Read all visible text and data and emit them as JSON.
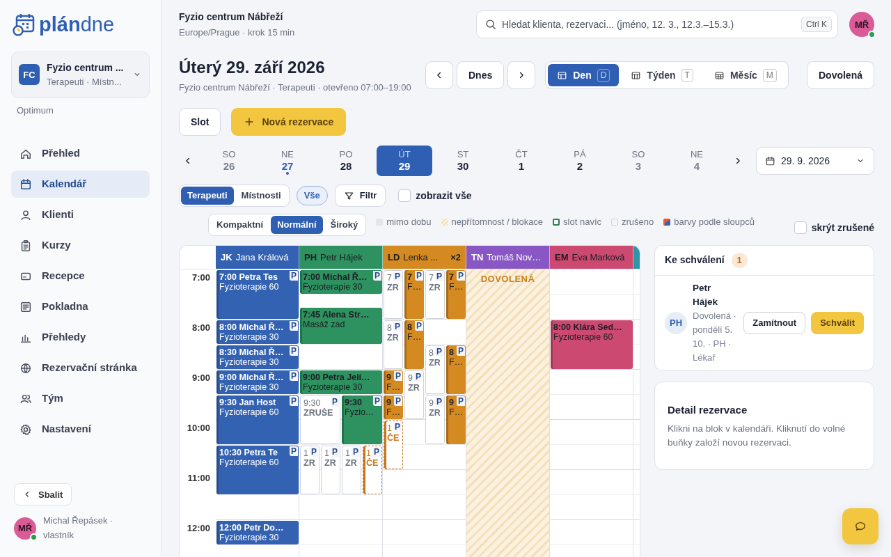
{
  "sidebar": {
    "logo": {
      "bold": "plán",
      "light": "dne"
    },
    "org": {
      "initials": "FC",
      "name": "Fyzio centrum ...",
      "sub": "Terapeuti · Místn..."
    },
    "plan": "Optimum",
    "items": [
      {
        "label": "Přehled",
        "selected": false
      },
      {
        "label": "Kalendář",
        "selected": true
      },
      {
        "label": "Klienti",
        "selected": false
      },
      {
        "label": "Kurzy",
        "selected": false
      },
      {
        "label": "Recepce",
        "selected": false
      },
      {
        "label": "Pokladna",
        "selected": false
      },
      {
        "label": "Přehledy",
        "selected": false
      },
      {
        "label": "Rezervační stránka",
        "selected": false
      },
      {
        "label": "Tým",
        "selected": false
      },
      {
        "label": "Nastavení",
        "selected": false
      }
    ],
    "collapse": "Sbalit",
    "user": {
      "initials": "MŘ",
      "text": "Michal Řepásek · vlastník",
      "online": true
    }
  },
  "header": {
    "title": "Fyzio centrum Nábřeží",
    "sub": "Europe/Prague · krok 15 min",
    "search": {
      "placeholder": "Hledat klienta, rezervaci... (jméno, 12. 3., 12.3.–15.3.)",
      "shortcut": "Ctrl K"
    },
    "avatar": {
      "initials": "MŘ",
      "online": true
    }
  },
  "day": {
    "title": "Úterý 29. září 2026",
    "sub": "Fyzio centrum Nábřeží · Terapeuti · otevřeno 07:00–19:00",
    "today": "Dnes",
    "views": [
      {
        "label": "Den",
        "key": "D",
        "selected": true
      },
      {
        "label": "Týden",
        "key": "T",
        "selected": false
      },
      {
        "label": "Měsíc",
        "key": "M",
        "selected": false
      }
    ],
    "vacation": "Dovolená",
    "slot": "Slot",
    "new": "Nová rezervace"
  },
  "days": [
    {
      "weekday": "SO",
      "day": "26",
      "selected": false,
      "muted": true,
      "today": false
    },
    {
      "weekday": "NE",
      "day": "27",
      "selected": false,
      "muted": false,
      "today": true
    },
    {
      "weekday": "PO",
      "day": "28",
      "selected": false,
      "muted": false,
      "today": false
    },
    {
      "weekday": "ÚT",
      "day": "29",
      "selected": true,
      "muted": false,
      "today": false
    },
    {
      "weekday": "ST",
      "day": "30",
      "selected": false,
      "muted": false,
      "today": false
    },
    {
      "weekday": "ČT",
      "day": "1",
      "selected": false,
      "muted": false,
      "today": false
    },
    {
      "weekday": "PÁ",
      "day": "2",
      "selected": false,
      "muted": false,
      "today": false
    },
    {
      "weekday": "SO",
      "day": "3",
      "selected": false,
      "muted": true,
      "today": false
    },
    {
      "weekday": "NE",
      "day": "4",
      "selected": false,
      "muted": true,
      "today": false
    }
  ],
  "date_picker": "29. 9. 2026",
  "filters": {
    "modes": [
      {
        "label": "Terapeuti",
        "selected": true
      },
      {
        "label": "Místnosti",
        "selected": false
      }
    ],
    "all": {
      "label": "Vše",
      "selected": true
    },
    "filter": "Filtr",
    "show_all": {
      "label": "zobrazit vše",
      "checked": false
    }
  },
  "density": [
    {
      "label": "Kompaktní",
      "selected": false
    },
    {
      "label": "Normální",
      "selected": true
    },
    {
      "label": "Široký",
      "selected": false
    }
  ],
  "legend": [
    {
      "kind": "off",
      "label": "mimo dobu"
    },
    {
      "kind": "absence",
      "label": "nepřítomnost / blokace"
    },
    {
      "kind": "extra",
      "label": "slot navíc"
    },
    {
      "kind": "cancelled",
      "label": "zrušeno"
    },
    {
      "kind": "colors",
      "label": "barvy podle sloupců"
    }
  ],
  "hide_cancelled": {
    "label": "skrýt zrušené",
    "checked": false
  },
  "calendar": {
    "hours": [
      "7:00",
      "8:00",
      "9:00",
      "10:00",
      "11:00",
      "12:00"
    ],
    "columns": [
      {
        "initials": "JK",
        "name": "Jana Králová",
        "color": "#3462b2",
        "clusters": [
          {
            "lanes": [
              [
                {
                  "kind": "booked",
                  "title": "7:00 Petra Tes",
                  "detail": "Fyzioterapie 60",
                  "tag": "P"
                }
              ]
            ]
          },
          {
            "lanes": [
              [
                {
                  "kind": "booked",
                  "title": "8:00 Michal Ř…",
                  "detail": "Fyzioterapie 30",
                  "tag": "P"
                }
              ]
            ]
          },
          {
            "lanes": [
              [
                {
                  "kind": "booked",
                  "title": "8:30 Michal Ř…",
                  "detail": "Fyzioterapie 30",
                  "tag": "P"
                }
              ]
            ]
          },
          {
            "lanes": [
              [
                {
                  "kind": "booked",
                  "title": "9:00 Michal Ř…",
                  "detail": "Fyzioterapie 30",
                  "tag": "P"
                }
              ]
            ]
          },
          {
            "lanes": [
              [
                {
                  "kind": "booked",
                  "title": "9:30 Jan Host",
                  "detail": "Fyzioterapie 60",
                  "tag": "P"
                }
              ]
            ]
          },
          {
            "lanes": [
              [
                {
                  "kind": "booked",
                  "title": "10:30 Petra Te",
                  "detail": "Fyzioterapie 60",
                  "tag": "P"
                }
              ]
            ]
          },
          {
            "lanes": [
              [
                {
                  "kind": "booked",
                  "title": "12:00 Petr Do…",
                  "detail": "Fyzioterapie 30"
                }
              ]
            ]
          }
        ]
      },
      {
        "initials": "PH",
        "name": "Petr Hájek",
        "color": "#2e9160",
        "clusters": [
          {
            "lanes": [
              [
                {
                  "kind": "booked",
                  "title": "7:00 Michal Ř…",
                  "detail": "Fyzioterapie 30",
                  "tag": "P"
                }
              ]
            ]
          },
          {
            "lanes": [
              [
                {
                  "kind": "booked",
                  "title": "7:45 Alena Str…",
                  "detail": "Masáž zad"
                }
              ]
            ]
          },
          {
            "lanes": [
              [
                {
                  "kind": "booked",
                  "title": "9:00 Petra Jelí…",
                  "detail": "Fyzioterapie 30"
                }
              ]
            ]
          },
          {
            "lanes": [
              [
                {
                  "kind": "cancelled",
                  "title": "9:30",
                  "detail": "ZRUŠE",
                  "tag": "P"
                }
              ],
              [
                {
                  "kind": "booked",
                  "title": "9:30",
                  "detail": "Fyzio…",
                  "tag": "P"
                }
              ]
            ]
          },
          {
            "lanes": [
              [
                {
                  "kind": "cancelled",
                  "title": "1",
                  "detail": "ZR",
                  "tag": "P"
                }
              ],
              [
                {
                  "kind": "cancelled",
                  "title": "1",
                  "detail": "ZR",
                  "tag": "P"
                }
              ],
              [
                {
                  "kind": "cancelled",
                  "title": "1",
                  "detail": "ZR",
                  "tag": "P"
                }
              ],
              [
                {
                  "kind": "pending",
                  "title": "1",
                  "detail": "ČE",
                  "tag": "P"
                }
              ]
            ]
          }
        ]
      },
      {
        "initials": "LD",
        "name": "Lenka ...",
        "count": "×2",
        "color": "#d48a20",
        "clusters": [
          {
            "lanes": [
              [
                {
                  "kind": "cancelled",
                  "title": "7",
                  "detail": "ZR",
                  "tag": "P"
                },
                {
                  "kind": "cancelled",
                  "title": "8",
                  "detail": "ZR",
                  "tag": "P"
                },
                {
                  "kind": "booked",
                  "title": "9",
                  "detail": "F…",
                  "tag": "P"
                },
                {
                  "kind": "booked",
                  "title": "9",
                  "detail": "F…",
                  "tag": "P"
                },
                {
                  "kind": "pending",
                  "title": "1",
                  "detail": "ČE",
                  "tag": "P"
                }
              ],
              [
                {
                  "kind": "booked",
                  "title": "7",
                  "detail": "F…",
                  "tag": "P"
                },
                {
                  "kind": "booked",
                  "title": "8",
                  "detail": "F…",
                  "tag": "P"
                },
                {
                  "kind": "cancelled",
                  "title": "9",
                  "detail": "ZR",
                  "tag": "P"
                }
              ],
              [
                {
                  "kind": "cancelled",
                  "title": "7",
                  "detail": "ZR",
                  "tag": "P"
                },
                {
                  "kind": "cancelled",
                  "title": "8",
                  "detail": "ZR",
                  "tag": "P"
                },
                {
                  "kind": "cancelled",
                  "title": "9",
                  "detail": "ZR",
                  "tag": "P"
                }
              ],
              [
                {
                  "kind": "booked",
                  "title": "7",
                  "detail": "F…",
                  "tag": "P"
                },
                {
                  "kind": "booked",
                  "title": "8",
                  "detail": "F…",
                  "tag": "P"
                },
                {
                  "kind": "booked",
                  "title": "9",
                  "detail": "F…",
                  "tag": "P"
                }
              ]
            ]
          }
        ]
      },
      {
        "initials": "TN",
        "name": "Tomáš Nov…",
        "color": "#8857c4",
        "absence": "DOVOLENÁ"
      },
      {
        "initials": "EM",
        "name": "Eva Marková",
        "color": "#cc4a72",
        "clusters": [
          {
            "lanes": [
              [
                {
                  "kind": "booked",
                  "title": "8:00 Klára Sed…",
                  "detail": "Fyzioterapie 60"
                }
              ]
            ]
          }
        ]
      }
    ],
    "clipped_column": {
      "color": "#2e97a6"
    }
  },
  "approvals": {
    "title": "Ke schválení",
    "count": "1",
    "items": [
      {
        "initials": "PH",
        "name": "Petr Hájek",
        "detail": "Dovolená · pondělí 5. 10. · PH · Lékař",
        "actions": [
          {
            "kind": "reject",
            "label": "Zamítnout"
          },
          {
            "kind": "approve",
            "label": "Schválit"
          }
        ]
      }
    ]
  },
  "detail": {
    "title": "Detail rezervace",
    "text": "Klikni na blok v kalendáři. Kliknutí do volné buňky založí novou rezervaci."
  }
}
